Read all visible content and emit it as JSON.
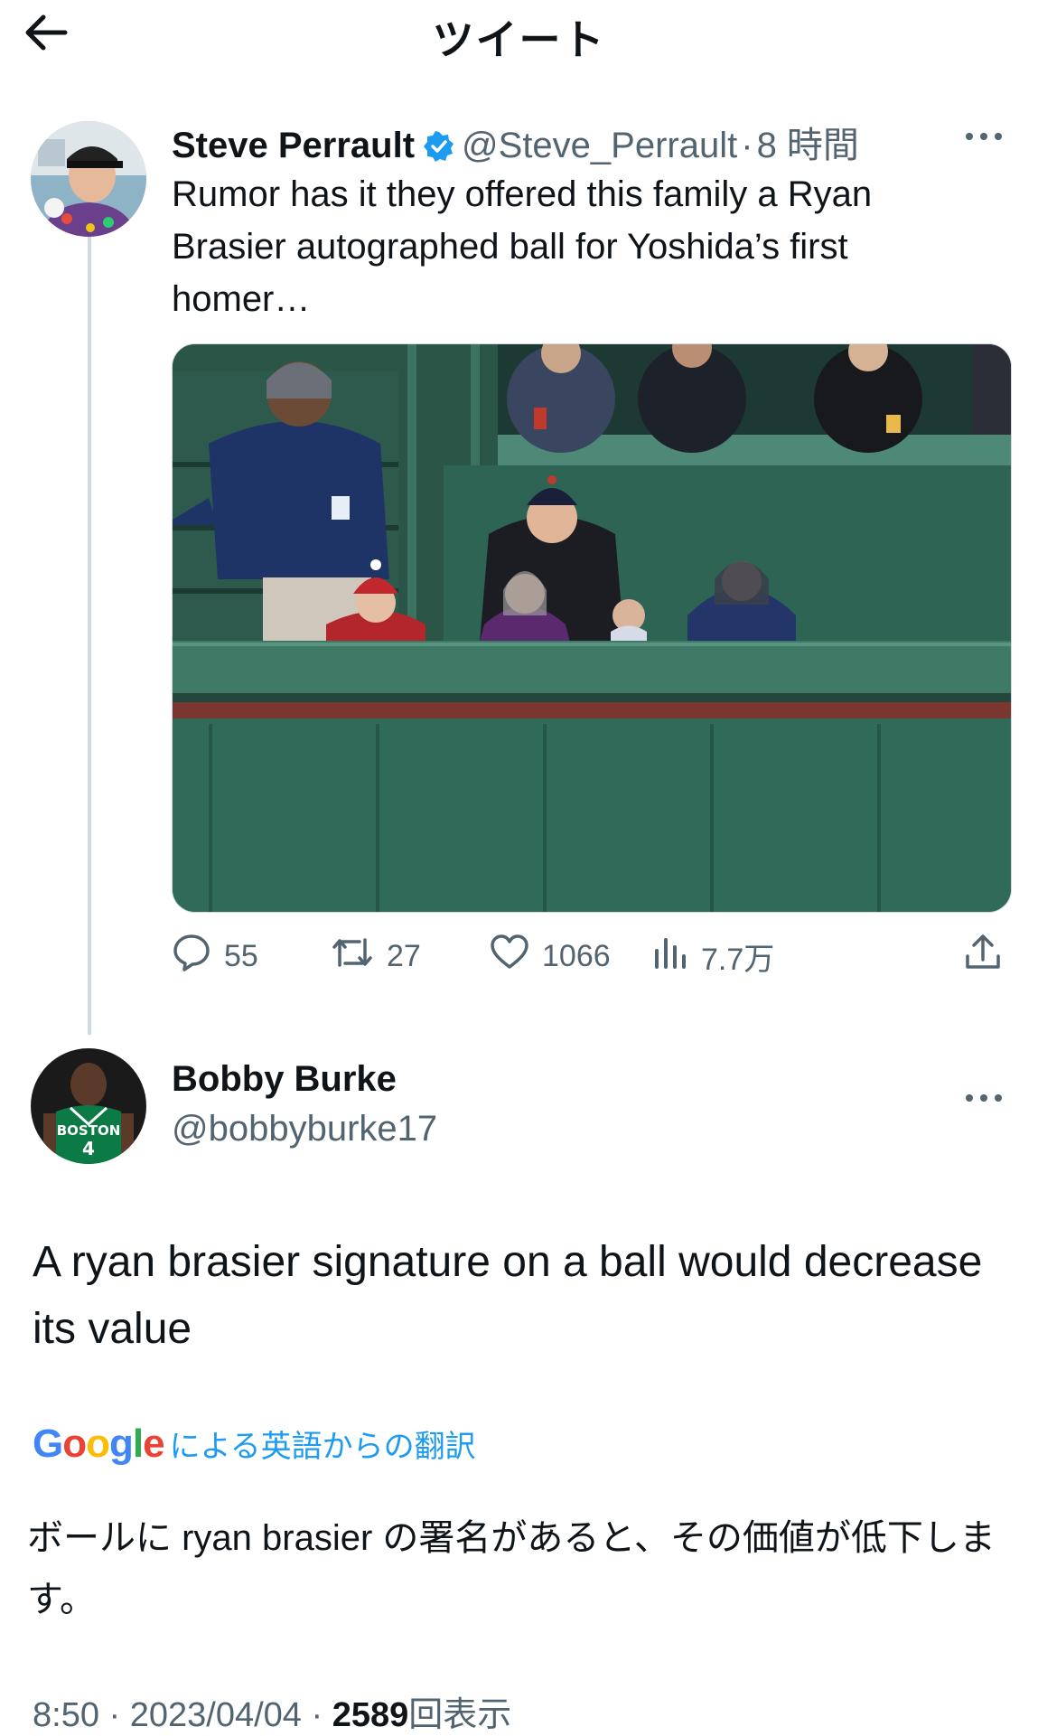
{
  "header": {
    "title": "ツイート"
  },
  "original_tweet": {
    "author_name": "Steve Perrault",
    "handle": "@Steve_Perrault",
    "separator": "·",
    "time_ago": "8 時間",
    "text": "Rumor has it they offered this family a Ryan Brasier autographed ball for Yoshida’s first homer…",
    "actions": {
      "replies": "55",
      "retweets": "27",
      "likes": "1066",
      "views": "7.7万"
    }
  },
  "reply_tweet": {
    "author_name": "Bobby Burke",
    "handle": "@bobbyburke17",
    "text": "A ryan brasier signature on a ball would decrease its value",
    "translate_brand": "Google",
    "translate_label": "による英語からの翻訳",
    "translated_text": "ボールに ryan brasier の署名があると、その価値が低下します。",
    "time": "8:50",
    "date": "2023/04/04",
    "separator": "·",
    "view_count": "2589",
    "view_label": "回表示"
  },
  "colors": {
    "accent": "#1d9bf0",
    "secondary_text": "#536471",
    "divider": "#cfd9de",
    "stadium_green": "#2f6b58"
  }
}
